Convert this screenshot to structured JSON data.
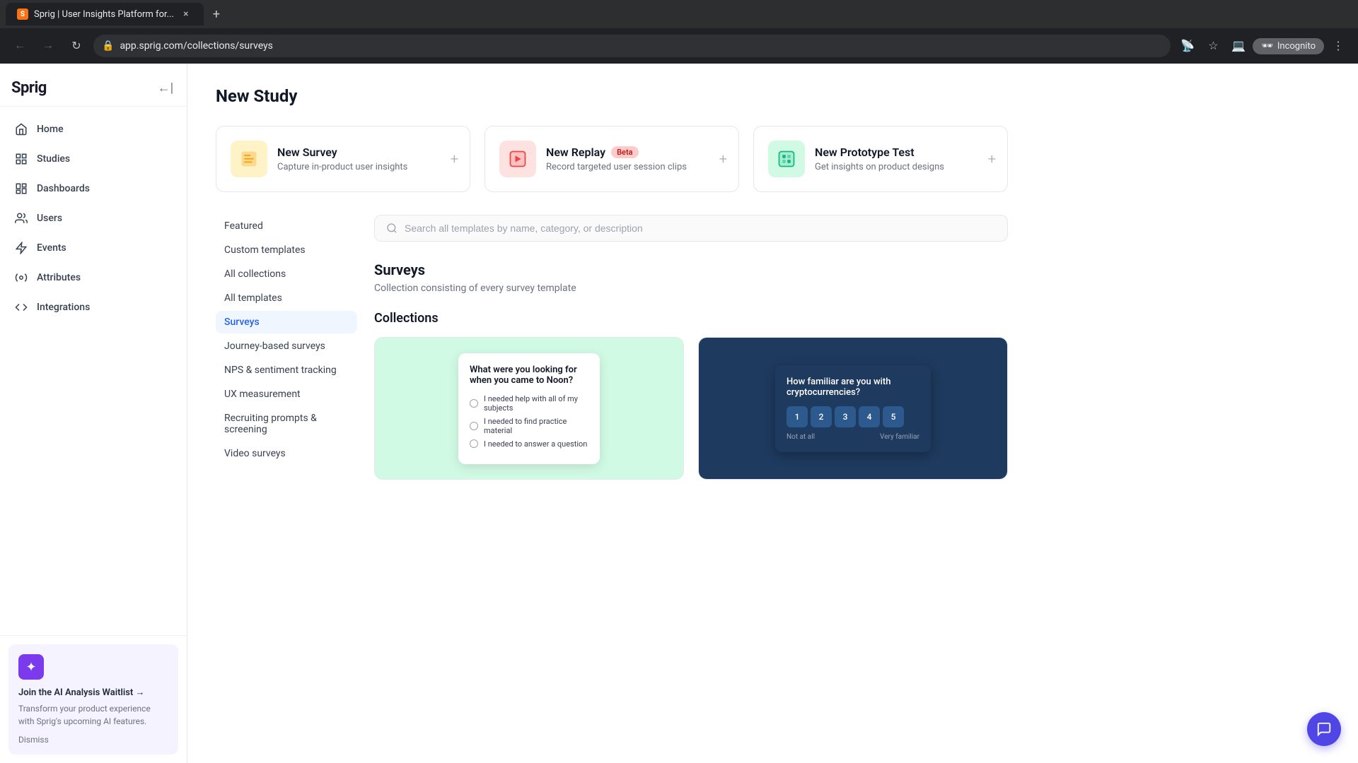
{
  "browser": {
    "tab_favicon": "S",
    "tab_title": "Sprig | User Insights Platform for...",
    "tab_close": "×",
    "new_tab": "+",
    "url": "app.sprig.com/collections/surveys",
    "incognito_label": "Incognito"
  },
  "sidebar": {
    "logo": "Sprig",
    "nav_items": [
      {
        "id": "home",
        "label": "Home",
        "icon": "🏠"
      },
      {
        "id": "studies",
        "label": "Studies",
        "icon": "📋"
      },
      {
        "id": "dashboards",
        "label": "Dashboards",
        "icon": "📊"
      },
      {
        "id": "users",
        "label": "Users",
        "icon": "👤"
      },
      {
        "id": "events",
        "label": "Events",
        "icon": "⚡"
      },
      {
        "id": "attributes",
        "label": "Attributes",
        "icon": "🔧"
      },
      {
        "id": "integrations",
        "label": "Integrations",
        "icon": "🔗"
      }
    ],
    "ai_banner": {
      "title": "Join the AI Analysis Waitlist →",
      "description": "Transform your product experience with Sprig's upcoming AI features.",
      "dismiss": "Dismiss"
    }
  },
  "page": {
    "title": "New Study",
    "study_cards": [
      {
        "id": "survey",
        "title": "New Survey",
        "description": "Capture in-product user insights",
        "icon": "📝",
        "icon_type": "survey",
        "badge": null,
        "add": "+"
      },
      {
        "id": "replay",
        "title": "New Replay",
        "description": "Record targeted user session clips",
        "icon": "🎬",
        "icon_type": "replay",
        "badge": "Beta",
        "add": "+"
      },
      {
        "id": "prototype",
        "title": "New Prototype Test",
        "description": "Get insights on product designs",
        "icon": "🎨",
        "icon_type": "prototype",
        "badge": null,
        "add": "+"
      }
    ],
    "template_nav": [
      {
        "id": "featured",
        "label": "Featured"
      },
      {
        "id": "custom",
        "label": "Custom templates"
      },
      {
        "id": "all-collections",
        "label": "All collections"
      },
      {
        "id": "all-templates",
        "label": "All templates"
      },
      {
        "id": "surveys",
        "label": "Surveys",
        "active": true
      },
      {
        "id": "journey",
        "label": "Journey-based surveys"
      },
      {
        "id": "nps",
        "label": "NPS & sentiment tracking"
      },
      {
        "id": "ux",
        "label": "UX measurement"
      },
      {
        "id": "recruiting",
        "label": "Recruiting prompts & screening"
      },
      {
        "id": "video",
        "label": "Video surveys"
      }
    ],
    "search": {
      "placeholder": "Search all templates by name, category, or description"
    },
    "surveys_section": {
      "title": "Surveys",
      "description": "Collection consisting of every survey template"
    },
    "collections_section": {
      "title": "Collections"
    },
    "collection_cards": [
      {
        "id": "journey",
        "preview_type": "green",
        "preview_question": "What were you looking for when you came to Noon?",
        "options": [
          "I needed help with all of my subjects",
          "I needed to find practice material",
          "I needed to answer a question"
        ]
      },
      {
        "id": "nps",
        "preview_type": "navy",
        "preview_question": "How familiar are you with cryptocurrencies?",
        "nps_numbers": [
          "1",
          "2",
          "3",
          "4",
          "5"
        ],
        "nps_label_left": "Not at all",
        "nps_label_right": "Very familiar"
      }
    ]
  }
}
